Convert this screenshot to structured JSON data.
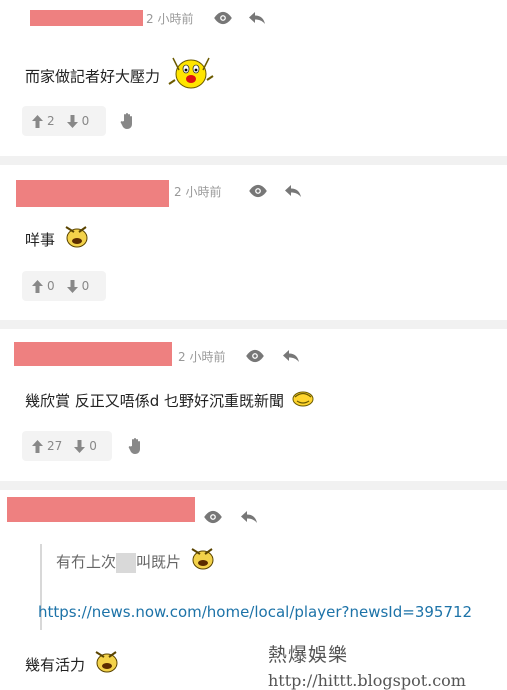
{
  "posts": [
    {
      "time": "2 小時前",
      "content": "而家做記者好大壓力",
      "upvotes": "2",
      "downvotes": "0"
    },
    {
      "time": "2 小時前",
      "content": "咩事",
      "upvotes": "0",
      "downvotes": "0"
    },
    {
      "time": "2 小時前",
      "content": "幾欣賞 反正又唔係d 乜野好沉重既新聞",
      "upvotes": "27",
      "downvotes": "0"
    },
    {
      "quote": "有冇上次",
      "quote_end": "叫既片",
      "link": "https://news.now.com/home/local/player?newsId=395712",
      "content": "幾有活力"
    }
  ],
  "watermark": {
    "title": "熱爆娛樂",
    "url": "http://hittt.blogspot.com"
  },
  "colors": {
    "redaction": "#ee8080",
    "link": "#1d73a8",
    "meta": "#999999"
  }
}
